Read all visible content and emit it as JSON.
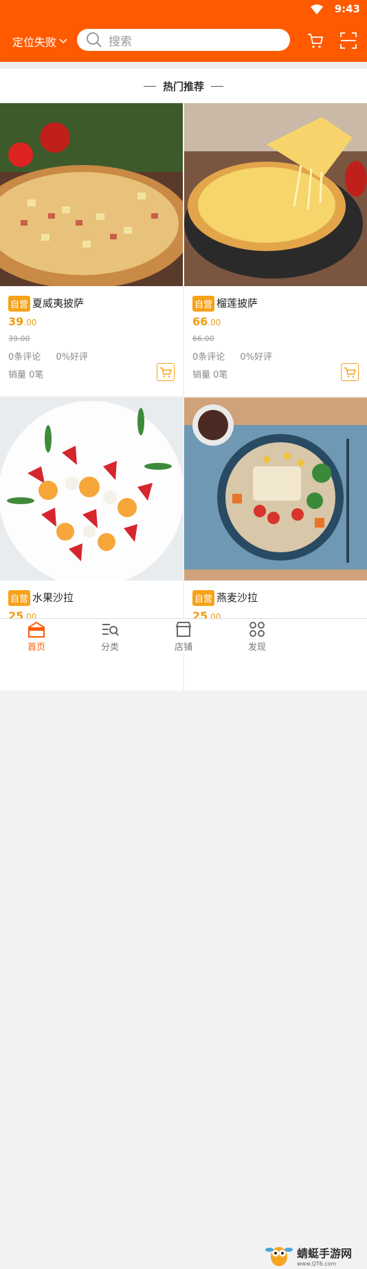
{
  "status": {
    "time": "9:43"
  },
  "header": {
    "location_label": "定位失败",
    "search_placeholder": "搜索"
  },
  "section": {
    "title": "热门推荐"
  },
  "products": [
    {
      "badge": "自营",
      "name": "夏威夷披萨",
      "price_int": "39",
      "price_dec": ".00",
      "old_price": "39.00",
      "reviews": "0条评论",
      "good_rate": "0%好评",
      "sales": "销量 0笔"
    },
    {
      "badge": "自营",
      "name": "榴莲披萨",
      "price_int": "66",
      "price_dec": ".00",
      "old_price": "66.00",
      "reviews": "0条评论",
      "good_rate": "0%好评",
      "sales": "销量 0笔"
    },
    {
      "badge": "自营",
      "name": "水果沙拉",
      "price_int": "25",
      "price_dec": ".00"
    },
    {
      "badge": "自营",
      "name": "燕麦沙拉",
      "price_int": "25",
      "price_dec": ".00"
    }
  ],
  "tabbar": {
    "tabs": [
      {
        "label": "首页",
        "icon": "home-icon",
        "active": true
      },
      {
        "label": "分类",
        "icon": "category-icon",
        "active": false
      },
      {
        "label": "店铺",
        "icon": "store-icon",
        "active": false
      },
      {
        "label": "发现",
        "icon": "discover-icon",
        "active": false
      }
    ]
  },
  "watermark": {
    "text": "蜻蜓手游网",
    "url": "www.QT6.com"
  },
  "colors": {
    "brand": "#ff5a00",
    "badge": "#f7a21a",
    "price": "#f29b12"
  }
}
